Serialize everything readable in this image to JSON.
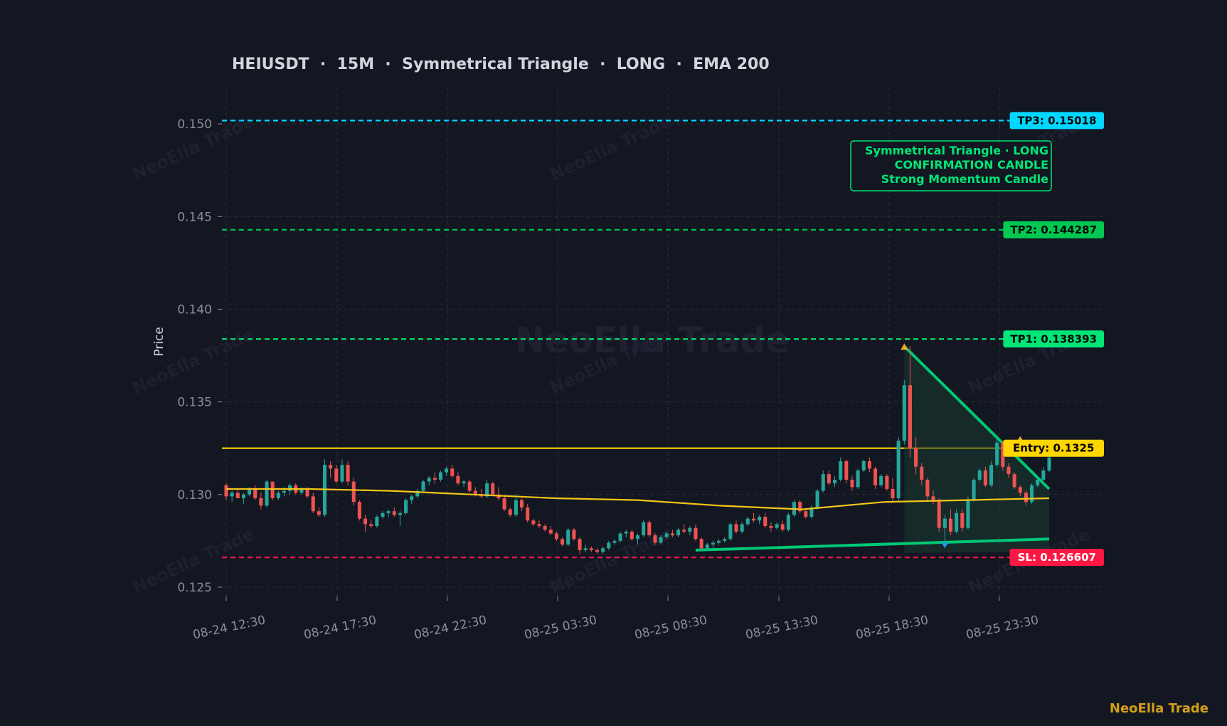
{
  "chart_data": {
    "type": "candlestick",
    "title": "HEIUSDT  ·  15M  ·  Symmetrical Triangle  ·  LONG  ·  EMA 200",
    "ylabel": "Price",
    "ylim": [
      0.1245,
      0.152
    ],
    "yticks": [
      "0.125",
      "0.130",
      "0.135",
      "0.140",
      "0.145",
      "0.150"
    ],
    "xticks": [
      "08-24 12:30",
      "08-24 17:30",
      "08-24 22:30",
      "08-25 03:30",
      "08-25 08:30",
      "08-25 13:30",
      "08-25 18:30",
      "08-25 23:30"
    ],
    "grid": true,
    "watermark": "NeoElla Trade",
    "levels": [
      {
        "label": "TP3: 0.15018",
        "value": 0.15018,
        "color": "#00d8ff"
      },
      {
        "label": "TP2: 0.144287",
        "value": 0.144287,
        "color": "#00c851"
      },
      {
        "label": "TP1: 0.138393",
        "value": 0.138393,
        "color": "#00e676"
      },
      {
        "label": "Entry: 0.1325",
        "value": 0.1325,
        "color": "#ffd600"
      },
      {
        "label": "SL: 0.126607",
        "value": 0.126607,
        "color": "#ff1744"
      }
    ],
    "annotation": [
      "Symmetrical Triangle · LONG",
      "CONFIRMATION CANDLE",
      "Strong Momentum Candle"
    ],
    "ema": {
      "name": "EMA 200",
      "color": "#f5c518",
      "values": [
        0.1303,
        0.1303,
        0.1302,
        0.13,
        0.1298,
        0.1297,
        0.1294,
        0.1292,
        0.1296,
        0.1297,
        0.1298
      ]
    },
    "candles_ohlc": [
      [
        0.1305,
        0.1306,
        0.1297,
        0.1299
      ],
      [
        0.1299,
        0.1302,
        0.1296,
        0.1301
      ],
      [
        0.1301,
        0.1303,
        0.1298,
        0.1298
      ],
      [
        0.1298,
        0.1301,
        0.1295,
        0.13
      ],
      [
        0.13,
        0.1304,
        0.1299,
        0.1303
      ],
      [
        0.1303,
        0.1305,
        0.1297,
        0.1298
      ],
      [
        0.1298,
        0.1301,
        0.1292,
        0.1294
      ],
      [
        0.1294,
        0.1308,
        0.1293,
        0.1307
      ],
      [
        0.1307,
        0.1307,
        0.1297,
        0.1298
      ],
      [
        0.1298,
        0.1302,
        0.1297,
        0.1301
      ],
      [
        0.1301,
        0.1304,
        0.1299,
        0.1302
      ],
      [
        0.1302,
        0.1306,
        0.13,
        0.1305
      ],
      [
        0.1305,
        0.1306,
        0.13,
        0.1301
      ],
      [
        0.1301,
        0.1304,
        0.13,
        0.1303
      ],
      [
        0.1303,
        0.1304,
        0.1298,
        0.1299
      ],
      [
        0.1299,
        0.1301,
        0.129,
        0.1291
      ],
      [
        0.1291,
        0.1293,
        0.1288,
        0.1289
      ],
      [
        0.1289,
        0.1319,
        0.1288,
        0.1316
      ],
      [
        0.1316,
        0.1318,
        0.1309,
        0.1314
      ],
      [
        0.1314,
        0.1316,
        0.1306,
        0.1307
      ],
      [
        0.1307,
        0.1319,
        0.1306,
        0.1316
      ],
      [
        0.1316,
        0.1318,
        0.1305,
        0.1307
      ],
      [
        0.1307,
        0.1309,
        0.1294,
        0.1296
      ],
      [
        0.1296,
        0.1297,
        0.1286,
        0.1287
      ],
      [
        0.1287,
        0.1289,
        0.128,
        0.1284
      ],
      [
        0.1284,
        0.1286,
        0.1282,
        0.1283
      ],
      [
        0.1283,
        0.1289,
        0.1282,
        0.1288
      ],
      [
        0.1288,
        0.1291,
        0.1287,
        0.129
      ],
      [
        0.129,
        0.1292,
        0.1288,
        0.1291
      ],
      [
        0.1291,
        0.1293,
        0.1288,
        0.1289
      ],
      [
        0.1289,
        0.1291,
        0.1283,
        0.129
      ],
      [
        0.129,
        0.1298,
        0.1289,
        0.1297
      ],
      [
        0.1297,
        0.13,
        0.1295,
        0.1299
      ],
      [
        0.1299,
        0.1303,
        0.1298,
        0.1302
      ],
      [
        0.1302,
        0.1308,
        0.1301,
        0.1307
      ],
      [
        0.1307,
        0.131,
        0.1305,
        0.1309
      ],
      [
        0.1309,
        0.1312,
        0.1306,
        0.1308
      ],
      [
        0.1308,
        0.1313,
        0.1307,
        0.1312
      ],
      [
        0.1312,
        0.1315,
        0.131,
        0.1314
      ],
      [
        0.1314,
        0.1316,
        0.1309,
        0.131
      ],
      [
        0.131,
        0.1312,
        0.1305,
        0.1306
      ],
      [
        0.1306,
        0.1308,
        0.1304,
        0.1307
      ],
      [
        0.1307,
        0.1308,
        0.1301,
        0.1302
      ],
      [
        0.1302,
        0.1304,
        0.1299,
        0.13
      ],
      [
        0.13,
        0.1303,
        0.1298,
        0.1299
      ],
      [
        0.1299,
        0.1308,
        0.1298,
        0.1306
      ],
      [
        0.1306,
        0.1307,
        0.1299,
        0.13
      ],
      [
        0.13,
        0.1304,
        0.1297,
        0.1298
      ],
      [
        0.1298,
        0.1299,
        0.1291,
        0.1292
      ],
      [
        0.1292,
        0.1293,
        0.1288,
        0.1289
      ],
      [
        0.1289,
        0.13,
        0.1288,
        0.1297
      ],
      [
        0.1297,
        0.1298,
        0.1291,
        0.1293
      ],
      [
        0.1293,
        0.1295,
        0.1285,
        0.1286
      ],
      [
        0.1286,
        0.1287,
        0.1283,
        0.1284
      ],
      [
        0.1284,
        0.1286,
        0.1282,
        0.1283
      ],
      [
        0.1283,
        0.1284,
        0.128,
        0.1281
      ],
      [
        0.1281,
        0.1283,
        0.1278,
        0.1279
      ],
      [
        0.1279,
        0.128,
        0.1275,
        0.1276
      ],
      [
        0.1276,
        0.1277,
        0.1272,
        0.1273
      ],
      [
        0.1273,
        0.1282,
        0.1272,
        0.1281
      ],
      [
        0.1281,
        0.1282,
        0.1275,
        0.1276
      ],
      [
        0.1276,
        0.1277,
        0.1268,
        0.127
      ],
      [
        0.127,
        0.1273,
        0.1269,
        0.1271
      ],
      [
        0.1271,
        0.1272,
        0.1269,
        0.127
      ],
      [
        0.127,
        0.1271,
        0.1268,
        0.1269
      ],
      [
        0.1269,
        0.1272,
        0.1268,
        0.1271
      ],
      [
        0.1271,
        0.1275,
        0.127,
        0.1274
      ],
      [
        0.1274,
        0.1276,
        0.1273,
        0.1275
      ],
      [
        0.1275,
        0.128,
        0.1274,
        0.1279
      ],
      [
        0.1279,
        0.1281,
        0.1277,
        0.128
      ],
      [
        0.128,
        0.1281,
        0.1275,
        0.1276
      ],
      [
        0.1276,
        0.1279,
        0.1273,
        0.1278
      ],
      [
        0.1278,
        0.1286,
        0.1277,
        0.1285
      ],
      [
        0.1285,
        0.1286,
        0.1277,
        0.1278
      ],
      [
        0.1278,
        0.1279,
        0.1273,
        0.1274
      ],
      [
        0.1274,
        0.1278,
        0.1273,
        0.1277
      ],
      [
        0.1277,
        0.128,
        0.1276,
        0.1279
      ],
      [
        0.1279,
        0.1281,
        0.1277,
        0.1278
      ],
      [
        0.1278,
        0.1282,
        0.1277,
        0.1281
      ],
      [
        0.1281,
        0.1284,
        0.1279,
        0.128
      ],
      [
        0.128,
        0.1283,
        0.1278,
        0.1282
      ],
      [
        0.1282,
        0.1284,
        0.1275,
        0.1276
      ],
      [
        0.1276,
        0.1277,
        0.127,
        0.1271
      ],
      [
        0.1271,
        0.1274,
        0.127,
        0.1273
      ],
      [
        0.1273,
        0.1275,
        0.1271,
        0.1274
      ],
      [
        0.1274,
        0.1276,
        0.1273,
        0.1275
      ],
      [
        0.1275,
        0.1277,
        0.1274,
        0.1276
      ],
      [
        0.1276,
        0.1285,
        0.1275,
        0.1284
      ],
      [
        0.1284,
        0.1286,
        0.1279,
        0.128
      ],
      [
        0.128,
        0.1285,
        0.1279,
        0.1284
      ],
      [
        0.1284,
        0.1288,
        0.1283,
        0.1287
      ],
      [
        0.1287,
        0.129,
        0.1285,
        0.1286
      ],
      [
        0.1286,
        0.1289,
        0.1284,
        0.1288
      ],
      [
        0.1288,
        0.129,
        0.1282,
        0.1283
      ],
      [
        0.1283,
        0.1285,
        0.128,
        0.1282
      ],
      [
        0.1282,
        0.1285,
        0.1281,
        0.1284
      ],
      [
        0.1284,
        0.1286,
        0.128,
        0.1281
      ],
      [
        0.1281,
        0.129,
        0.128,
        0.1289
      ],
      [
        0.1289,
        0.1297,
        0.1288,
        0.1296
      ],
      [
        0.1296,
        0.1297,
        0.129,
        0.1291
      ],
      [
        0.1291,
        0.1292,
        0.1287,
        0.1288
      ],
      [
        0.1288,
        0.1294,
        0.1287,
        0.1293
      ],
      [
        0.1293,
        0.1303,
        0.1292,
        0.1302
      ],
      [
        0.1302,
        0.1313,
        0.1301,
        0.1311
      ],
      [
        0.1311,
        0.1313,
        0.1305,
        0.1306
      ],
      [
        0.1306,
        0.131,
        0.1304,
        0.1308
      ],
      [
        0.1308,
        0.132,
        0.1307,
        0.1318
      ],
      [
        0.1318,
        0.1319,
        0.1306,
        0.1308
      ],
      [
        0.1308,
        0.131,
        0.1302,
        0.1304
      ],
      [
        0.1304,
        0.1314,
        0.1303,
        0.1313
      ],
      [
        0.1313,
        0.1319,
        0.1312,
        0.1318
      ],
      [
        0.1318,
        0.132,
        0.1312,
        0.1314
      ],
      [
        0.1314,
        0.1315,
        0.1303,
        0.1305
      ],
      [
        0.1305,
        0.1311,
        0.1304,
        0.131
      ],
      [
        0.131,
        0.1311,
        0.1302,
        0.1303
      ],
      [
        0.1303,
        0.1309,
        0.1296,
        0.1298
      ],
      [
        0.1298,
        0.1331,
        0.1296,
        0.1329
      ],
      [
        0.1329,
        0.1362,
        0.1327,
        0.1359
      ],
      [
        0.1359,
        0.138,
        0.132,
        0.1325
      ],
      [
        0.1325,
        0.1331,
        0.1311,
        0.1315
      ],
      [
        0.1315,
        0.1317,
        0.1305,
        0.1308
      ],
      [
        0.1308,
        0.1309,
        0.1297,
        0.1299
      ],
      [
        0.1299,
        0.1302,
        0.1295,
        0.1297
      ],
      [
        0.1297,
        0.1298,
        0.128,
        0.1282
      ],
      [
        0.1282,
        0.1289,
        0.1273,
        0.1287
      ],
      [
        0.1287,
        0.1292,
        0.1278,
        0.128
      ],
      [
        0.128,
        0.1292,
        0.1279,
        0.129
      ],
      [
        0.129,
        0.1292,
        0.128,
        0.1282
      ],
      [
        0.1282,
        0.1299,
        0.1281,
        0.1297
      ],
      [
        0.1297,
        0.1309,
        0.1296,
        0.1308
      ],
      [
        0.1308,
        0.1314,
        0.1307,
        0.1313
      ],
      [
        0.1313,
        0.1315,
        0.1304,
        0.1305
      ],
      [
        0.1305,
        0.1318,
        0.1304,
        0.1316
      ],
      [
        0.1316,
        0.133,
        0.1315,
        0.1328
      ],
      [
        0.1328,
        0.1329,
        0.1313,
        0.1315
      ],
      [
        0.1315,
        0.1317,
        0.1309,
        0.1311
      ],
      [
        0.1311,
        0.1312,
        0.1303,
        0.1304
      ],
      [
        0.1304,
        0.1305,
        0.1299,
        0.1301
      ],
      [
        0.1301,
        0.1302,
        0.1294,
        0.1296
      ],
      [
        0.1296,
        0.1306,
        0.1295,
        0.1305
      ],
      [
        0.1305,
        0.1309,
        0.1304,
        0.1308
      ],
      [
        0.1308,
        0.1315,
        0.1307,
        0.1313
      ],
      [
        0.1313,
        0.1321,
        0.1312,
        0.132
      ]
    ],
    "triangle": {
      "upper": [
        0.138,
        0.1303
      ],
      "lower": [
        0.127,
        0.1276
      ]
    }
  },
  "brand": "NeoElla Trade"
}
